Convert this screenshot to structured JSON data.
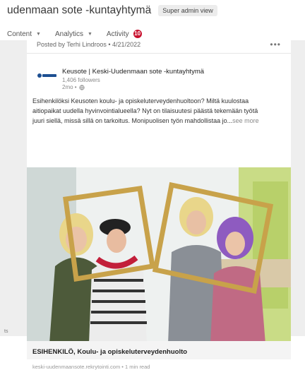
{
  "header": {
    "title": "udenmaan sote -kuntayhtymä",
    "badge": "Super admin view"
  },
  "tabs": [
    {
      "label": "Content"
    },
    {
      "label": "Analytics"
    },
    {
      "label": "Activity",
      "badge": "10"
    }
  ],
  "post": {
    "posted_by": "Posted by Terhi Lindroos  •  4/21/2022",
    "more": "•••",
    "org_name": "Keusote | Keski-Uudenmaan sote -kuntayhtymä",
    "followers": "1,406 followers",
    "age": "2mo •",
    "text_lines": [
      "Esihenkilöksi Keusoten koulu- ja opiskeluterveydenhuoltoon? Miltä kuulostaa",
      "aitiopaikat uudella hyvinvointialueella? Nyt on tilaisuutesi päästä tekemään työtä",
      "juuri siellä, missä sillä on tarkoitus. Monipuolisen työn mahdollistaa jo..."
    ],
    "see_more": "see more",
    "link_title": "ESIHENKILÖ, Koulu- ja opiskeluterveydenhuolto",
    "link_source": "keski-uudenmaansote.rekrytointi.com • 1 min read"
  },
  "icons": {
    "logo": "keusote-logo",
    "globe": "globe-icon",
    "more": "more-options-icon",
    "chevron": "chevron-down-icon"
  },
  "colors": {
    "activity_badge": "#c8102e",
    "frame_gold": "#c8a24a"
  },
  "bottom_fragment": "ts"
}
